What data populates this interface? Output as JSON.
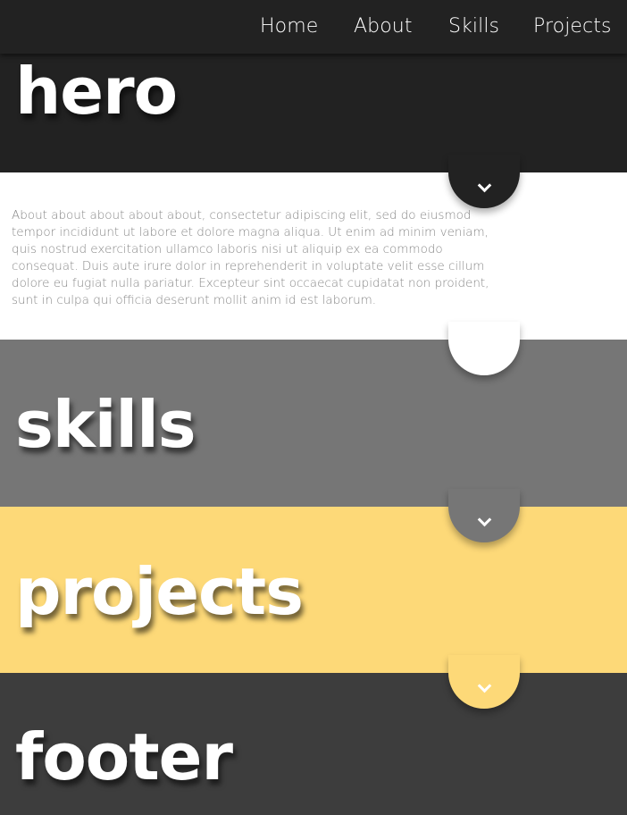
{
  "nav": {
    "items": [
      {
        "label": "Home"
      },
      {
        "label": "About"
      },
      {
        "label": "Skills"
      },
      {
        "label": "Projects"
      }
    ]
  },
  "sections": {
    "hero": {
      "title": "hero",
      "color": "#222222"
    },
    "about": {
      "color": "#ffffff",
      "text": "About about about about about, consectetur adipiscing elit, sed do eiusmod tempor incididunt ut labore et dolore magna aliqua. Ut enim ad minim veniam, quis nostrud exercitation ullamco laboris nisi ut aliquip ex ea commodo consequat. Duis aute irure dolor in reprehenderit in voluptate velit esse cillum dolore eu fugiat nulla pariatur. Excepteur sint occaecat cupidatat non proident, sunt in culpa qui officia deserunt mollit anim id est laborum."
    },
    "skills": {
      "title": "skills",
      "color": "#767676"
    },
    "projects": {
      "title": "projects",
      "color": "#fdd978"
    },
    "footer": {
      "title": "footer",
      "color": "#3d3d3d"
    }
  },
  "icons": {
    "scroll_down": "chevron-down-icon"
  }
}
